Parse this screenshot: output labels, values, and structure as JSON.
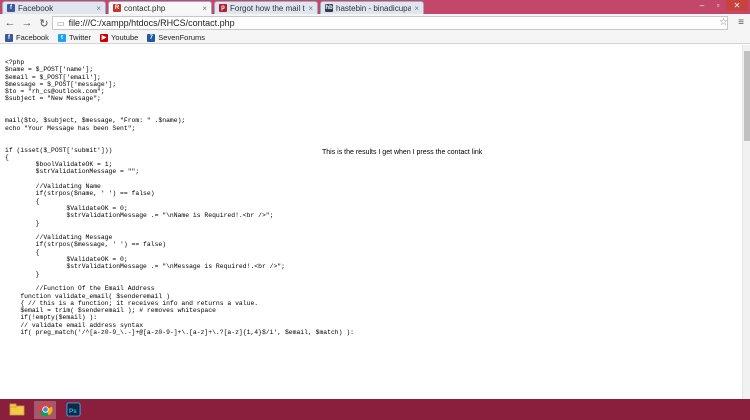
{
  "tabs": [
    {
      "label": "Facebook",
      "favicon": "facebook-icon",
      "favicon_char": "f",
      "favicon_color": "#3b5998",
      "active": false
    },
    {
      "label": "contact.php",
      "favicon": "page-icon",
      "favicon_char": "R",
      "favicon_color": "#c0392b",
      "active": true
    },
    {
      "label": "Forgot how the mail to fu",
      "favicon": "forum-icon",
      "favicon_char": "p",
      "favicon_color": "#a23",
      "active": false
    },
    {
      "label": "hastebin - binadicupa",
      "favicon": "hastebin-icon",
      "favicon_char": "hb",
      "favicon_color": "#2c3e50",
      "active": false
    }
  ],
  "address": {
    "url": "file:///C:/xampp/htdocs/RHCS/contact.php"
  },
  "bookmarks": [
    {
      "label": "Facebook",
      "icon": "facebook-icon",
      "char": "f",
      "color": "#3b5998"
    },
    {
      "label": "Twitter",
      "icon": "twitter-icon",
      "char": "t",
      "color": "#1da1f2"
    },
    {
      "label": "Youtube",
      "icon": "youtube-icon",
      "char": "▶",
      "color": "#cc0000"
    },
    {
      "label": "SevenForums",
      "icon": "sevenforums-icon",
      "char": "7",
      "color": "#1e5a9c"
    }
  ],
  "content": {
    "code": "<?php\n$name = $_POST['name'];\n$email = $_POST['email'];\n$message = $_POST['message'];\n$to = \"rh_cs@outlook.com\";\n$subject = \"New Message\";\n\n\nmail($to, $subject, $message, \"From: \" .$name);\necho \"Your Message has been Sent\";\n\n\nif (isset($_POST['submit']))\n{\n        $boolValidateOK = 1;\n        $strValidationMessage = \"\";\n\n        //Validating Name\n        if(strpos($name, ' ') == false)\n        {\n                $ValidateOK = 0;\n                $strValidationMessage .= \"\\nName is Required!.<br />\";\n        }\n\n        //Validating Message\n        if(strpos($message, ' ') == false)\n        {\n                $ValidateOK = 0;\n                $strValidationMessage .= \"\\nMessage is Required!.<br />\";\n        }\n\n        //Function Of the Email Address\n    function validate_email( $senderemail )\n    { // this is a function; it receives info and returns a value.\n    $email = trim( $senderemail ); # removes whitespace\n    if(!empty($email) ):\n    // validate email address syntax\n    if( preg_match('/^[a-z0-9_\\.-]+@[a-z0-9-]+\\.[a-z]+\\.?[a-z]{1,4}$/i', $email, $match) ):",
    "annotation": "This is the results I get when I press the contact link"
  },
  "taskbar": [
    {
      "icon": "file-explorer-icon",
      "active": false
    },
    {
      "icon": "chrome-icon",
      "active": true
    },
    {
      "icon": "photoshop-icon",
      "active": false
    }
  ]
}
